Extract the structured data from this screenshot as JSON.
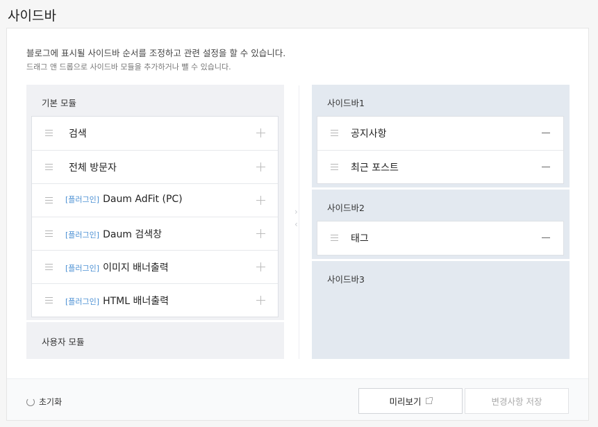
{
  "page": {
    "title": "사이드바"
  },
  "description": {
    "line1": "블로그에 표시될 사이드바 순서를 조정하고 관련 설정을 할 수 있습니다.",
    "line2": "드래그 앤 드롭으로 사이드바 모듈을 추가하거나 뺄 수 있습니다."
  },
  "basic_modules": {
    "title": "기본 모듈",
    "items": [
      {
        "tag": "",
        "label": "검색"
      },
      {
        "tag": "",
        "label": "전체 방문자"
      },
      {
        "tag": "[플러그인]",
        "label": "Daum AdFit (PC)"
      },
      {
        "tag": "[플러그인]",
        "label": "Daum 검색창"
      },
      {
        "tag": "[플러그인]",
        "label": "이미지 배너출력"
      },
      {
        "tag": "[플러그인]",
        "label": "HTML 배너출력"
      }
    ]
  },
  "user_modules": {
    "title": "사용자 모듈"
  },
  "sidebars": [
    {
      "title": "사이드바1",
      "items": [
        "공지사항",
        "최근 포스트"
      ]
    },
    {
      "title": "사이드바2",
      "items": [
        "태그"
      ]
    },
    {
      "title": "사이드바3",
      "items": []
    }
  ],
  "footer": {
    "reset_label": "초기화",
    "preview_label": "미리보기",
    "save_label": "변경사항 저장"
  },
  "icons": {
    "drag": "drag-handle-icon",
    "add": "plus-icon",
    "remove": "minus-icon",
    "reset": "refresh-icon",
    "external": "external-link-icon"
  }
}
